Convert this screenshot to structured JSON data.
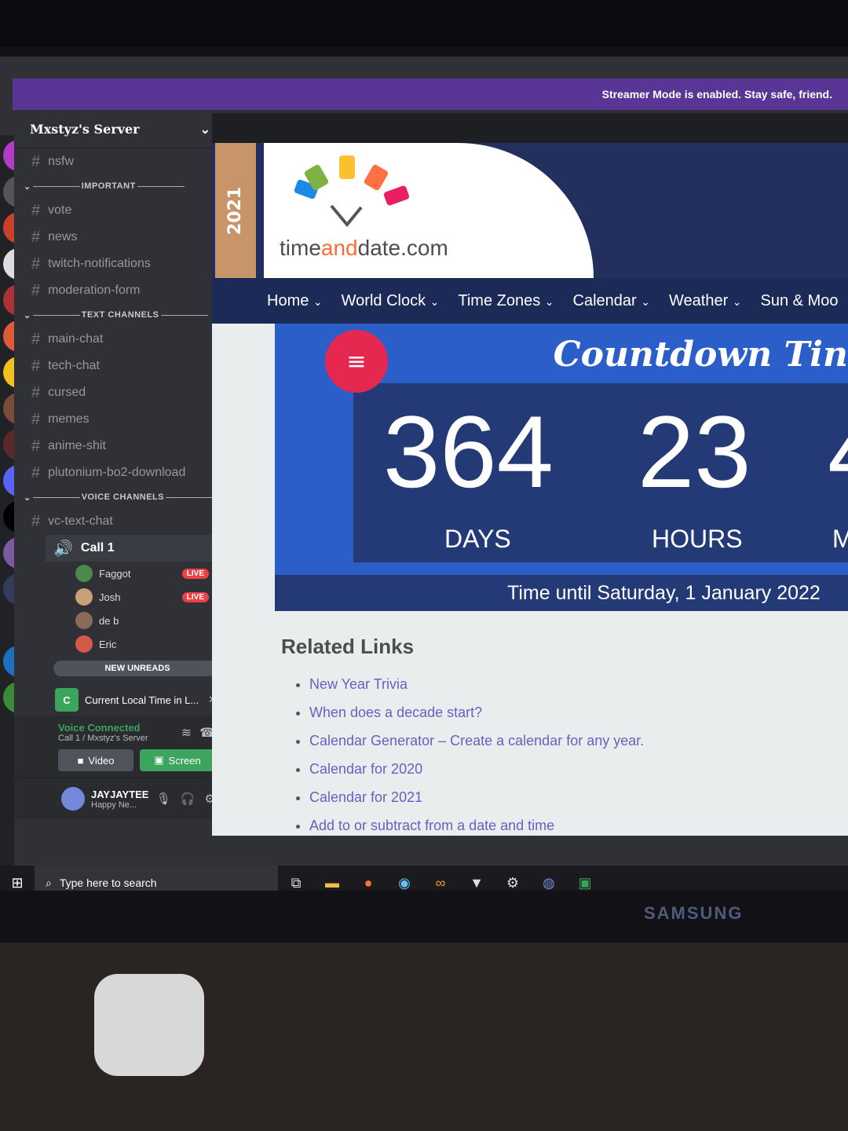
{
  "banner": {
    "text": "Streamer Mode is enabled. Stay safe, friend."
  },
  "server": {
    "name": "Mxstyz's Server",
    "top_channel": "nsfw",
    "categories": [
      {
        "name": "IMPORTANT",
        "channels": [
          "vote",
          "news",
          "twitch-notifications",
          "moderation-form"
        ]
      },
      {
        "name": "TEXT CHANNELS",
        "channels": [
          "main-chat",
          "tech-chat",
          "cursed",
          "memes",
          "anime-shit",
          "plutonium-bo2-download"
        ]
      },
      {
        "name": "VOICE CHANNELS",
        "channels": [
          "vc-text-chat"
        ]
      }
    ],
    "voice_channel": "Call 1",
    "voice_users": [
      {
        "name": "Faggot",
        "live": "LIVE",
        "color": "#4e8a4b"
      },
      {
        "name": "Josh",
        "live": "LIVE",
        "color": "#c9a07a"
      },
      {
        "name": "de b",
        "live": "",
        "color": "#8a6a5a"
      },
      {
        "name": "Eric",
        "live": "",
        "color": "#d35a4a"
      }
    ],
    "new_unreads": "NEW UNREADS",
    "activity": "Current Local Time in L...",
    "voice_status": "Voice Connected",
    "voice_sub": "Call 1 / Mxstyz's Server",
    "video_label": "Video",
    "screen_label": "Screen",
    "user": {
      "name": "JAYJAYTEE",
      "status": "Happy Ne..."
    }
  },
  "site": {
    "year": "2021",
    "logo_time": "time",
    "logo_and": "and",
    "logo_date": "date.com",
    "nav": [
      "Home",
      "World Clock",
      "Time Zones",
      "Calendar",
      "Weather",
      "Sun & Moo"
    ],
    "countdown_title": "Countdown Tin",
    "days": "364",
    "hours": "23",
    "days_label": "DAYS",
    "hours_label": "HOURS",
    "minutes_partial": "M",
    "minutes_num_partial": "4",
    "time_until": "Time until Saturday, 1 January 2022",
    "related_title": "Related Links",
    "related": [
      "New Year Trivia",
      "When does a decade start?",
      "Calendar Generator – Create a calendar for any year.",
      "Calendar for 2020",
      "Calendar for 2021",
      "Add to or subtract from a date and time"
    ]
  },
  "taskbar": {
    "search_placeholder": "Type here to search"
  },
  "monitor_brand": "SAMSUNG"
}
